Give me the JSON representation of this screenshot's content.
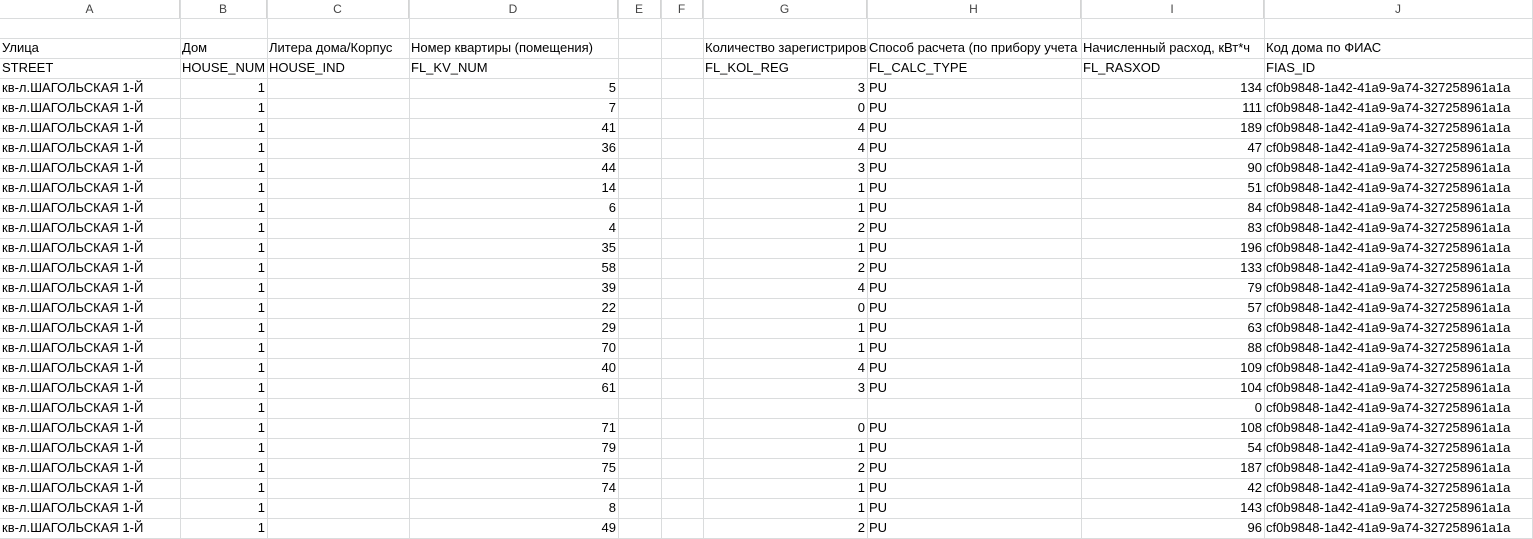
{
  "columns": [
    "A",
    "B",
    "C",
    "D",
    "E",
    "F",
    "G",
    "H",
    "I",
    "J"
  ],
  "headers_ru": {
    "street": "Улица",
    "house": "Дом",
    "house_ind": "Литера дома/Корпус",
    "kv": "Номер квартиры (помещения)",
    "kol_reg": "Количество зарегистрированных",
    "calc_type": "Способ расчета (по прибору учета",
    "rasxod": "Начисленный расход, кВт*ч",
    "fias": "Код дома по ФИАС"
  },
  "headers_code": {
    "street": "STREET",
    "house": "HOUSE_NUM",
    "house_ind": "HOUSE_IND",
    "kv": "FL_KV_NUM",
    "kol_reg": "FL_KOL_REG",
    "calc_type": "FL_CALC_TYPE",
    "rasxod": "FL_RASXOD",
    "fias": "FIAS_ID"
  },
  "rows": [
    {
      "street": "кв-л.ШАГОЛЬСКАЯ 1-Й",
      "house": "1",
      "kv": "5",
      "kol": "3",
      "calc": "PU",
      "rasxod": "134",
      "fias": "cf0b9848-1a42-41a9-9a74-327258961a1a"
    },
    {
      "street": "кв-л.ШАГОЛЬСКАЯ 1-Й",
      "house": "1",
      "kv": "7",
      "kol": "0",
      "calc": "PU",
      "rasxod": "111",
      "fias": "cf0b9848-1a42-41a9-9a74-327258961a1a"
    },
    {
      "street": "кв-л.ШАГОЛЬСКАЯ 1-Й",
      "house": "1",
      "kv": "41",
      "kol": "4",
      "calc": "PU",
      "rasxod": "189",
      "fias": "cf0b9848-1a42-41a9-9a74-327258961a1a"
    },
    {
      "street": "кв-л.ШАГОЛЬСКАЯ 1-Й",
      "house": "1",
      "kv": "36",
      "kol": "4",
      "calc": "PU",
      "rasxod": "47",
      "fias": "cf0b9848-1a42-41a9-9a74-327258961a1a"
    },
    {
      "street": "кв-л.ШАГОЛЬСКАЯ 1-Й",
      "house": "1",
      "kv": "44",
      "kol": "3",
      "calc": "PU",
      "rasxod": "90",
      "fias": "cf0b9848-1a42-41a9-9a74-327258961a1a"
    },
    {
      "street": "кв-л.ШАГОЛЬСКАЯ 1-Й",
      "house": "1",
      "kv": "14",
      "kol": "1",
      "calc": "PU",
      "rasxod": "51",
      "fias": "cf0b9848-1a42-41a9-9a74-327258961a1a"
    },
    {
      "street": "кв-л.ШАГОЛЬСКАЯ 1-Й",
      "house": "1",
      "kv": "6",
      "kol": "1",
      "calc": "PU",
      "rasxod": "84",
      "fias": "cf0b9848-1a42-41a9-9a74-327258961a1a"
    },
    {
      "street": "кв-л.ШАГОЛЬСКАЯ 1-Й",
      "house": "1",
      "kv": "4",
      "kol": "2",
      "calc": "PU",
      "rasxod": "83",
      "fias": "cf0b9848-1a42-41a9-9a74-327258961a1a"
    },
    {
      "street": "кв-л.ШАГОЛЬСКАЯ 1-Й",
      "house": "1",
      "kv": "35",
      "kol": "1",
      "calc": "PU",
      "rasxod": "196",
      "fias": "cf0b9848-1a42-41a9-9a74-327258961a1a"
    },
    {
      "street": "кв-л.ШАГОЛЬСКАЯ 1-Й",
      "house": "1",
      "kv": "58",
      "kol": "2",
      "calc": "PU",
      "rasxod": "133",
      "fias": "cf0b9848-1a42-41a9-9a74-327258961a1a"
    },
    {
      "street": "кв-л.ШАГОЛЬСКАЯ 1-Й",
      "house": "1",
      "kv": "39",
      "kol": "4",
      "calc": "PU",
      "rasxod": "79",
      "fias": "cf0b9848-1a42-41a9-9a74-327258961a1a"
    },
    {
      "street": "кв-л.ШАГОЛЬСКАЯ 1-Й",
      "house": "1",
      "kv": "22",
      "kol": "0",
      "calc": "PU",
      "rasxod": "57",
      "fias": "cf0b9848-1a42-41a9-9a74-327258961a1a"
    },
    {
      "street": "кв-л.ШАГОЛЬСКАЯ 1-Й",
      "house": "1",
      "kv": "29",
      "kol": "1",
      "calc": "PU",
      "rasxod": "63",
      "fias": "cf0b9848-1a42-41a9-9a74-327258961a1a"
    },
    {
      "street": "кв-л.ШАГОЛЬСКАЯ 1-Й",
      "house": "1",
      "kv": "70",
      "kol": "1",
      "calc": "PU",
      "rasxod": "88",
      "fias": "cf0b9848-1a42-41a9-9a74-327258961a1a"
    },
    {
      "street": "кв-л.ШАГОЛЬСКАЯ 1-Й",
      "house": "1",
      "kv": "40",
      "kol": "4",
      "calc": "PU",
      "rasxod": "109",
      "fias": "cf0b9848-1a42-41a9-9a74-327258961a1a"
    },
    {
      "street": "кв-л.ШАГОЛЬСКАЯ 1-Й",
      "house": "1",
      "kv": "61",
      "kol": "3",
      "calc": "PU",
      "rasxod": "104",
      "fias": "cf0b9848-1a42-41a9-9a74-327258961a1a"
    },
    {
      "street": "кв-л.ШАГОЛЬСКАЯ 1-Й",
      "house": "1",
      "kv": "",
      "kol": "",
      "calc": "",
      "rasxod": "0",
      "fias": "cf0b9848-1a42-41a9-9a74-327258961a1a"
    },
    {
      "street": "кв-л.ШАГОЛЬСКАЯ 1-Й",
      "house": "1",
      "kv": "71",
      "kol": "0",
      "calc": "PU",
      "rasxod": "108",
      "fias": "cf0b9848-1a42-41a9-9a74-327258961a1a"
    },
    {
      "street": "кв-л.ШАГОЛЬСКАЯ 1-Й",
      "house": "1",
      "kv": "79",
      "kol": "1",
      "calc": "PU",
      "rasxod": "54",
      "fias": "cf0b9848-1a42-41a9-9a74-327258961a1a"
    },
    {
      "street": "кв-л.ШАГОЛЬСКАЯ 1-Й",
      "house": "1",
      "kv": "75",
      "kol": "2",
      "calc": "PU",
      "rasxod": "187",
      "fias": "cf0b9848-1a42-41a9-9a74-327258961a1a"
    },
    {
      "street": "кв-л.ШАГОЛЬСКАЯ 1-Й",
      "house": "1",
      "kv": "74",
      "kol": "1",
      "calc": "PU",
      "rasxod": "42",
      "fias": "cf0b9848-1a42-41a9-9a74-327258961a1a"
    },
    {
      "street": "кв-л.ШАГОЛЬСКАЯ 1-Й",
      "house": "1",
      "kv": "8",
      "kol": "1",
      "calc": "PU",
      "rasxod": "143",
      "fias": "cf0b9848-1a42-41a9-9a74-327258961a1a"
    },
    {
      "street": "кв-л.ШАГОЛЬСКАЯ 1-Й",
      "house": "1",
      "kv": "49",
      "kol": "2",
      "calc": "PU",
      "rasxod": "96",
      "fias": "cf0b9848-1a42-41a9-9a74-327258961a1a"
    }
  ]
}
